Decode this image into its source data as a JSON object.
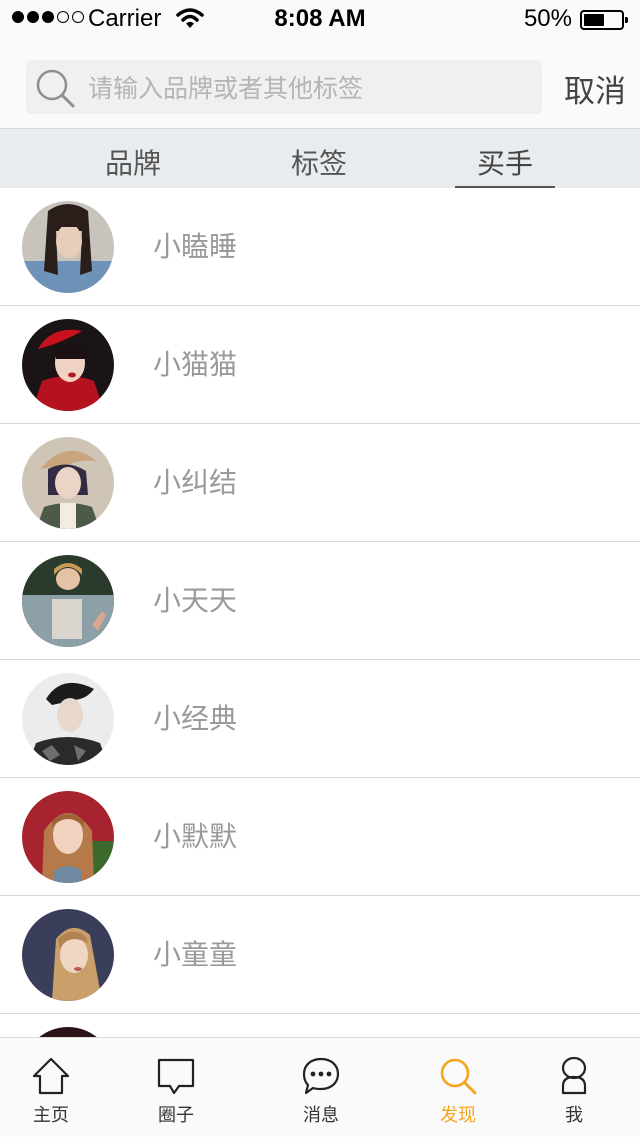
{
  "status_bar": {
    "carrier": "Carrier",
    "time": "8:08 AM",
    "battery": "50%"
  },
  "search": {
    "placeholder": "请输入品牌或者其他标签",
    "value": "",
    "cancel_label": "取消"
  },
  "tabs": [
    {
      "label": "品牌",
      "active": false
    },
    {
      "label": "标签",
      "active": false
    },
    {
      "label": "买手",
      "active": true
    }
  ],
  "buyers": [
    {
      "name": "小瞌睡"
    },
    {
      "name": "小猫猫"
    },
    {
      "name": "小纠结"
    },
    {
      "name": "小天天"
    },
    {
      "name": "小经典"
    },
    {
      "name": "小默默"
    },
    {
      "name": "小童童"
    },
    {
      "name": ""
    }
  ],
  "tabbar": {
    "items": [
      {
        "label": "主页",
        "icon": "home-icon"
      },
      {
        "label": "圈子",
        "icon": "chat-bubble-icon"
      },
      {
        "label": "消息",
        "icon": "message-dots-icon"
      },
      {
        "label": "发现",
        "icon": "search-icon",
        "active": true
      },
      {
        "label": "我",
        "icon": "profile-icon"
      }
    ]
  },
  "colors": {
    "accent": "#f5a51b",
    "name_text": "#9a9a9a",
    "tabs_bg": "#e9ecee"
  }
}
